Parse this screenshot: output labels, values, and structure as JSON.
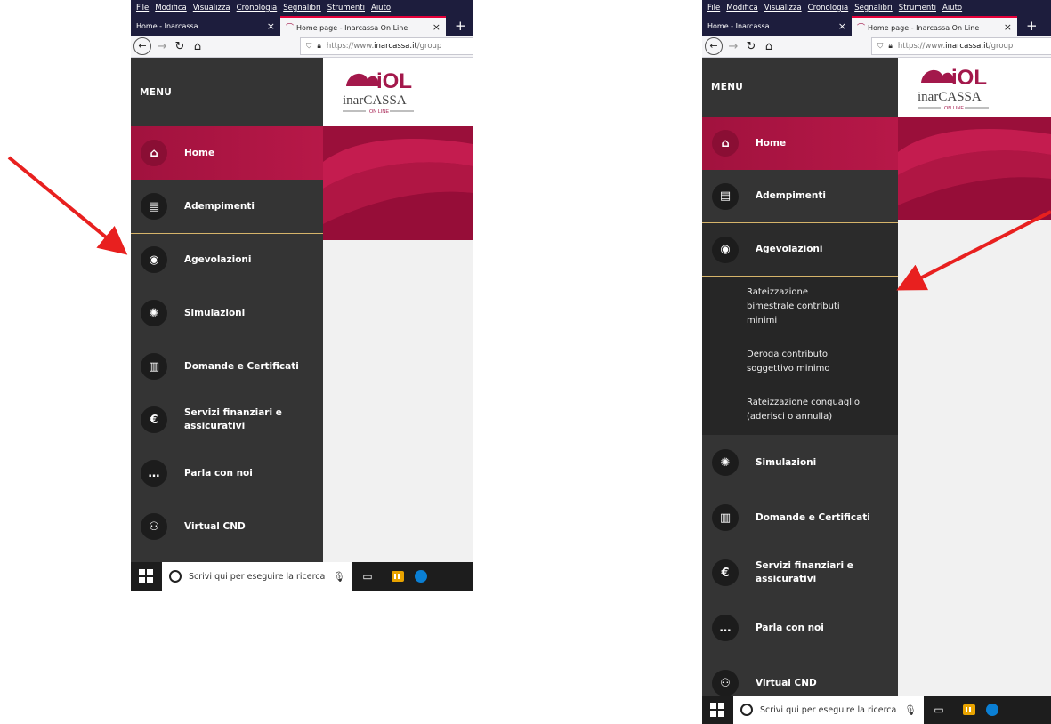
{
  "browser": {
    "menu_items": [
      "File",
      "Modifica",
      "Visualizza",
      "Cronologia",
      "Segnalibri",
      "Strumenti",
      "Aiuto"
    ],
    "tabs": [
      {
        "label": "Home - Inarcassa",
        "active": false
      },
      {
        "label": "Home page - Inarcassa On Line",
        "active": true
      }
    ],
    "new_tab_symbol": "+",
    "close_symbol": "×",
    "url_prefix": "https://www.",
    "url_domain": "inarcassa.it",
    "url_suffix": "/group"
  },
  "app": {
    "menu_title": "MENU",
    "brand": {
      "logo_mark": "iOL",
      "logo_name": "inarCASSA",
      "logo_tag": "ON LINE"
    },
    "menu_items": [
      {
        "label": "Home",
        "icon": "house-icon"
      },
      {
        "label": "Adempimenti",
        "icon": "clipboard-icon"
      },
      {
        "label": "Agevolazioni",
        "icon": "medal-icon"
      },
      {
        "label": "Simulazioni",
        "icon": "chip-icon"
      },
      {
        "label": "Domande e Certificati",
        "icon": "documents-icon"
      },
      {
        "label": "Servizi finanziari e assicurativi",
        "icon": "shield-euro-icon"
      },
      {
        "label": "Parla con noi",
        "icon": "chat-icon"
      },
      {
        "label": "Virtual CND",
        "icon": "group-icon"
      }
    ],
    "agevolazioni_submenu": [
      "Rateizzazione bimestrale contributi minimi",
      "Deroga contributo soggettivo minimo",
      "Rateizzazione conguaglio (aderisci o annulla)"
    ]
  },
  "taskbar": {
    "search_placeholder": "Scrivi qui per eseguire la ricerca"
  },
  "colors": {
    "accent": "#a3184b",
    "sidebar": "#343434",
    "highlight_line": "#d6b46a",
    "arrow": "#e8201f"
  }
}
